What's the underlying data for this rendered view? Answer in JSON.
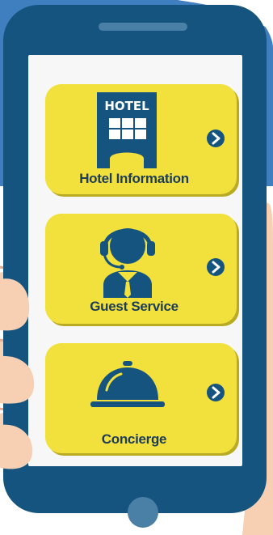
{
  "cards": [
    {
      "label": "Hotel Information",
      "icon": "hotel-building-icon",
      "sign": "HOTEL",
      "arrow_icon": "chevron-right-icon"
    },
    {
      "label": "Guest Service",
      "icon": "headset-agent-icon",
      "arrow_icon": "chevron-right-icon"
    },
    {
      "label": "Concierge",
      "icon": "service-bell-icon",
      "arrow_icon": "chevron-right-icon"
    }
  ],
  "colors": {
    "background_blue": "#3f7fc0",
    "phone_body": "#15547f",
    "phone_accent": "#4a7fa6",
    "card_yellow": "#f2e13c",
    "text_dark": "#1d3c57",
    "hand_skin": "#f7d0b4",
    "hand_shadow": "#e9a98a"
  }
}
